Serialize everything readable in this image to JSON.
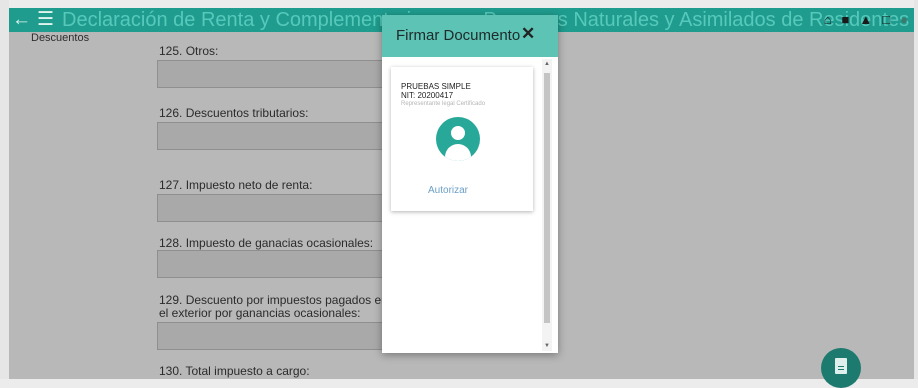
{
  "topbar": {
    "title": "Declaración de Renta y Complementarios para Personas Naturales y Asimilados de Residentes",
    "icons": [
      "back-arrow-icon",
      "hamburger-menu-icon",
      "home-icon",
      "folder-icon",
      "bell-icon",
      "calendar-icon"
    ],
    "back_glyph": "←",
    "menu_glyph": "☰"
  },
  "form": {
    "section_label": "Descuentos",
    "fields": [
      {
        "label": "125. Otros:",
        "value": ""
      },
      {
        "label": "126. Descuentos tributarios:",
        "value": ""
      },
      {
        "label": "127. Impuesto neto de renta:",
        "value": ""
      },
      {
        "label": "128. Impuesto de ganacias ocasionales:",
        "value": ""
      },
      {
        "label": "129. Descuento por impuestos pagados en el exterior por ganancias ocasionales:",
        "value": ""
      },
      {
        "label": "130. Total impuesto a cargo:",
        "value": ""
      }
    ]
  },
  "modal": {
    "title": "Firmar Documento",
    "close_glyph": "✕",
    "card": {
      "name": "PRUEBAS SIMPLE",
      "nit": "NIT: 20200417",
      "role": "Representante legal Certificado",
      "action": "Autorizar"
    }
  },
  "colors": {
    "header_teal": "#1f9c8e",
    "modal_header": "#5cc3b5",
    "avatar": "#27a899",
    "link": "#6b9fc7",
    "fab": "#1d7a6f"
  }
}
